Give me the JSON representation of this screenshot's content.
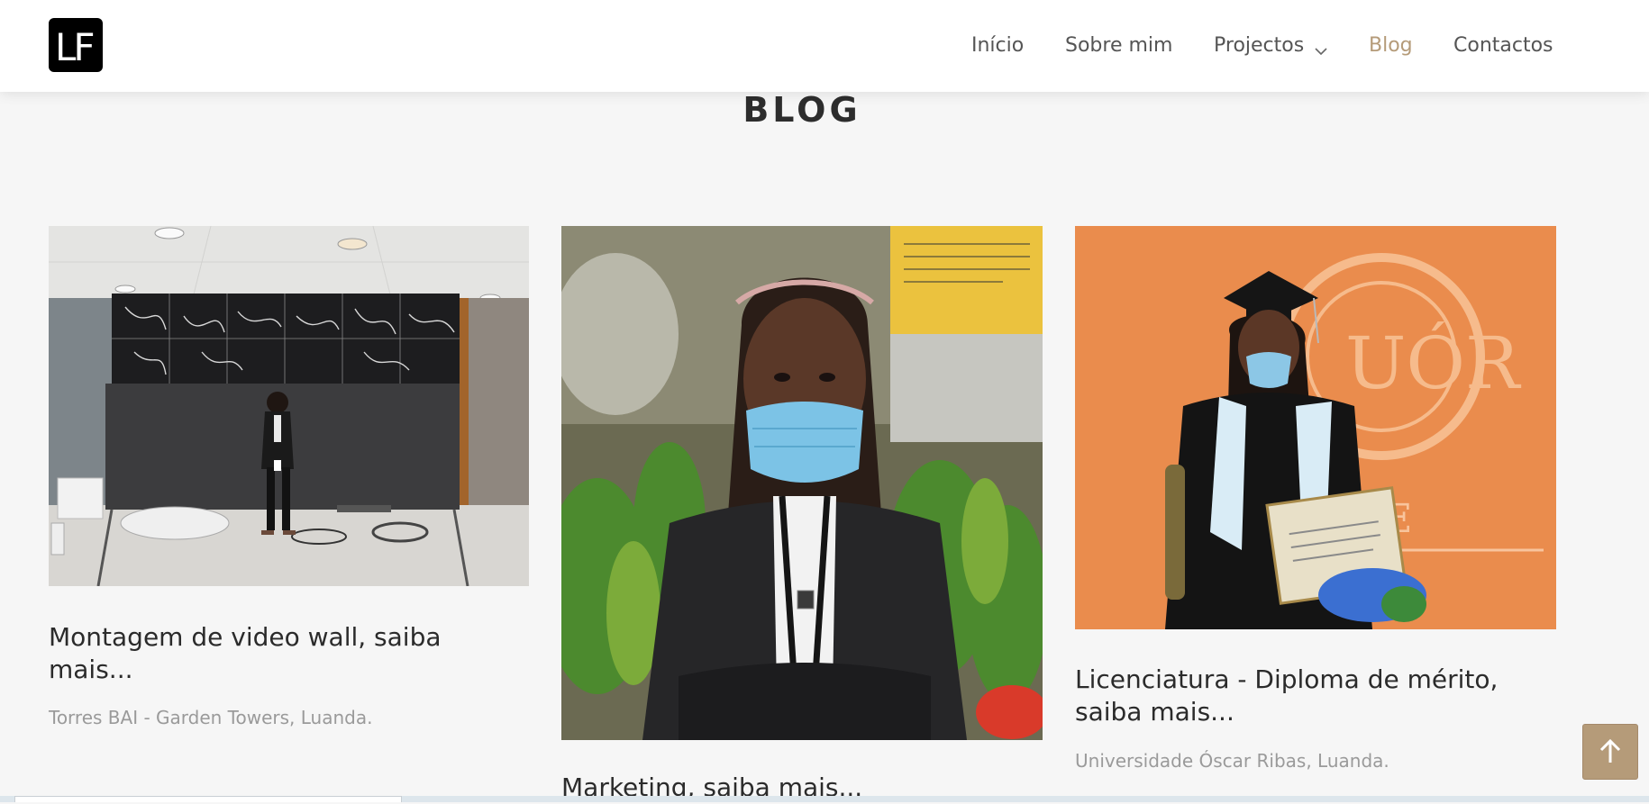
{
  "logo": {
    "text": "LF"
  },
  "nav": {
    "items": [
      {
        "label": "Início"
      },
      {
        "label": "Sobre mim"
      },
      {
        "label": "Projectos"
      },
      {
        "label": "Blog"
      },
      {
        "label": "Contactos"
      }
    ]
  },
  "page": {
    "title": "BLOG"
  },
  "posts": [
    {
      "title": "Montagem de video wall, saiba mais...",
      "location": "Torres BAI - Garden Towers, Luanda."
    },
    {
      "title": "Marketing, saiba mais...",
      "location": ""
    },
    {
      "title": "Licenciatura - Diploma de mérito, saiba mais...",
      "location": "Universidade Óscar Ribas, Luanda."
    }
  ],
  "colors": {
    "accent": "#b59b79",
    "background": "#f6f6f6",
    "header": "#ffffff",
    "text": "#2b2b2b",
    "muted": "#9a9a9a"
  },
  "icons": {
    "dropdown": "chevron-down-icon",
    "back_to_top": "arrow-up-icon"
  }
}
